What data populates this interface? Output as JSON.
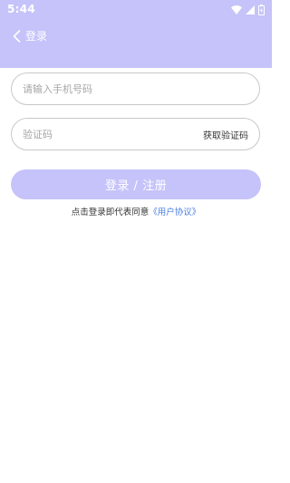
{
  "status_bar": {
    "time": "5:44",
    "icons": [
      "wifi-icon",
      "signal-icon",
      "battery-charging-icon"
    ]
  },
  "header": {
    "back_icon": "chevron-left-icon",
    "title": "登录",
    "background": "#c5c3f9"
  },
  "form": {
    "phone_placeholder": "请输入手机号码",
    "code_placeholder": "验证码",
    "get_code_label": "获取验证码",
    "submit_label": "登录 / 注册",
    "submit_color": "#c5c3f9"
  },
  "agreement": {
    "prefix": "点击登录即代表同意",
    "link_label": "《用户协议》",
    "link_color": "#4a7fe0"
  }
}
